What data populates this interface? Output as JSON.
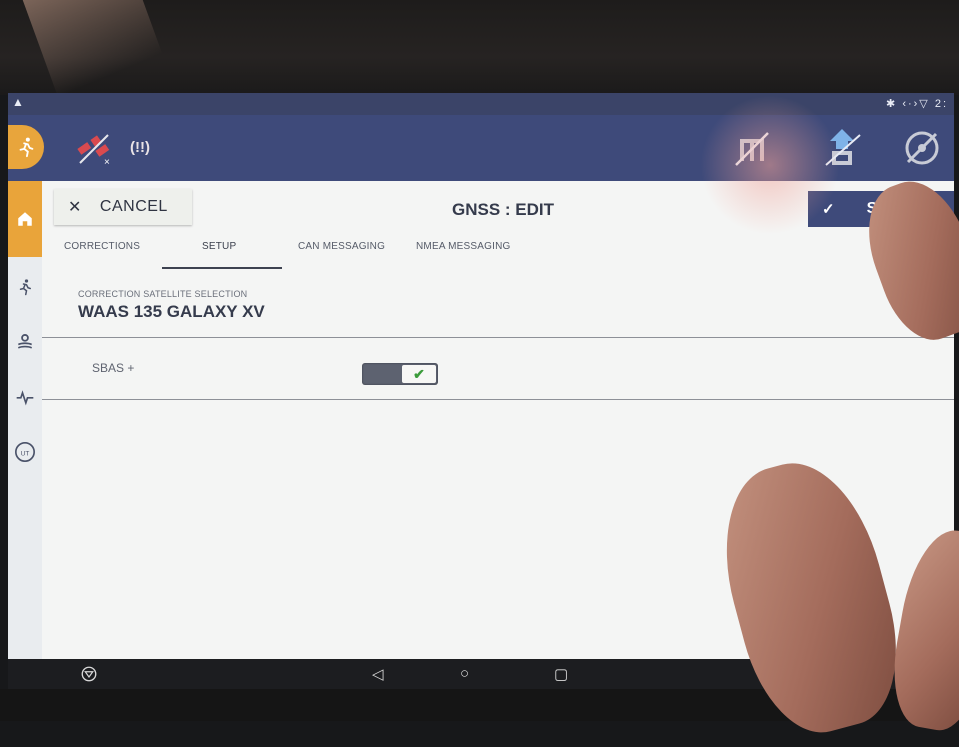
{
  "status_bar": {
    "left_icon": "warning-triangle-icon",
    "right_text": "✱ ‹·›▽ 2:"
  },
  "app_bar": {
    "signal_warning": "(!!)",
    "icons": [
      "running-person-icon",
      "satellite-off-icon",
      "implement-off-icon",
      "vehicle-upload-icon",
      "steering-off-icon"
    ]
  },
  "rail": {
    "items": [
      "home-icon",
      "running-person-icon",
      "gear-field-icon",
      "activity-pulse-icon",
      "ut-icon"
    ],
    "ut_label": "UT"
  },
  "header": {
    "cancel_label": "CANCEL",
    "title": "GNSS : EDIT",
    "save_label": "S"
  },
  "tabs": [
    {
      "label": "CORRECTIONS",
      "active": false
    },
    {
      "label": "SETUP",
      "active": true
    },
    {
      "label": "CAN MESSAGING",
      "active": false
    },
    {
      "label": "NMEA MESSAGING",
      "active": false
    }
  ],
  "setup": {
    "correction_label": "CORRECTION SATELLITE SELECTION",
    "correction_value": "WAAS 135 GALAXY XV",
    "sbas_label": "SBAS +",
    "sbas_enabled": true
  },
  "colors": {
    "app_bar": "#3e4a7a",
    "accent_orange": "#e8a53c",
    "toggle_check": "#3c9c3b"
  }
}
